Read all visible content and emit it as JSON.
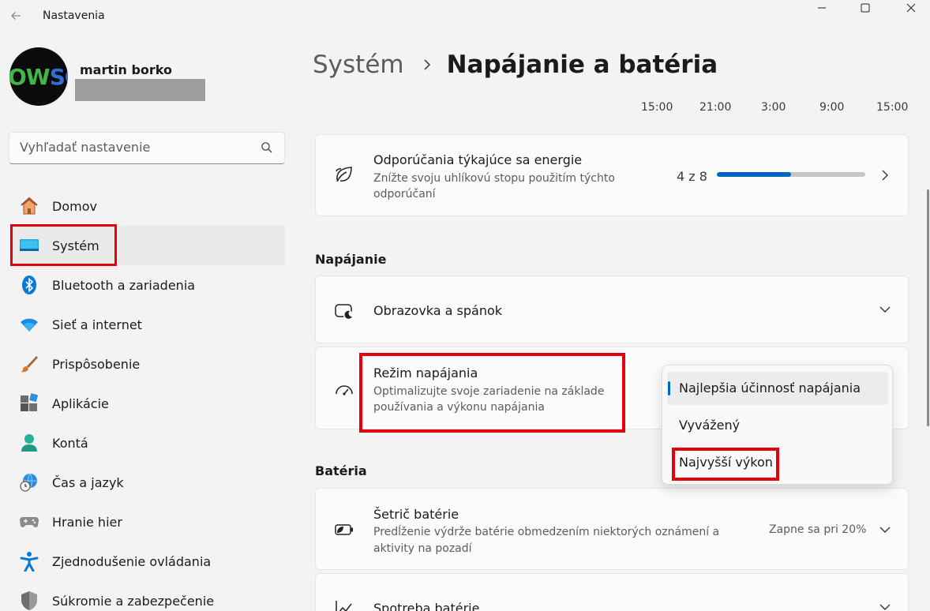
{
  "app": {
    "title": "Nastavenia"
  },
  "user": {
    "name": "martin borko",
    "avatar_text": "OWSC"
  },
  "search": {
    "placeholder": "Vyhľadať nastavenie"
  },
  "nav": {
    "items": [
      {
        "label": "Domov",
        "icon": "home-icon"
      },
      {
        "label": "Systém",
        "icon": "system-icon",
        "active": true
      },
      {
        "label": "Bluetooth a zariadenia",
        "icon": "bluetooth-icon"
      },
      {
        "label": "Sieť a internet",
        "icon": "wifi-icon"
      },
      {
        "label": "Prispôsobenie",
        "icon": "brush-icon"
      },
      {
        "label": "Aplikácie",
        "icon": "apps-icon"
      },
      {
        "label": "Kontá",
        "icon": "account-icon"
      },
      {
        "label": "Čas a jazyk",
        "icon": "clock-globe-icon"
      },
      {
        "label": "Hranie hier",
        "icon": "gamepad-icon"
      },
      {
        "label": "Zjednodušenie ovládania",
        "icon": "accessibility-icon"
      },
      {
        "label": "Súkromie a zabezpečenie",
        "icon": "shield-icon"
      }
    ]
  },
  "breadcrumb": {
    "parent": "Systém",
    "current": "Napájanie a batéria"
  },
  "timeline": [
    "15:00",
    "21:00",
    "3:00",
    "9:00",
    "15:00"
  ],
  "energy_card": {
    "title": "Odporúčania týkajúce sa energie",
    "subtitle_line1": "Znížte svoju uhlíkovú stopu použitím týchto",
    "subtitle_line2": "odporúčaní",
    "progress_label": "4 z 8",
    "progress_fraction": 0.5
  },
  "sections": {
    "power": "Napájanie",
    "battery": "Batéria"
  },
  "screen_sleep": {
    "title": "Obrazovka a spánok"
  },
  "power_mode": {
    "title": "Režim napájania",
    "subtitle_line1": "Optimalizujte svoje zariadenie na základe",
    "subtitle_line2": "používania a výkonu napájania",
    "options": [
      "Najlepšia účinnosť napájania",
      "Vyvážený",
      "Najvyšší výkon"
    ],
    "selected": "Najlepšia účinnosť napájania"
  },
  "battery_saver": {
    "title": "Šetrič batérie",
    "subtitle_line1": "Predĺženie výdrže batérie obmedzením niektorých oznámení a",
    "subtitle_line2": "aktivity na pozadí",
    "value": "Zapne sa pri 20%"
  },
  "battery_usage": {
    "title": "Spotreba batérie"
  },
  "colors": {
    "accent": "#0067c0",
    "highlight": "#e3000f"
  }
}
